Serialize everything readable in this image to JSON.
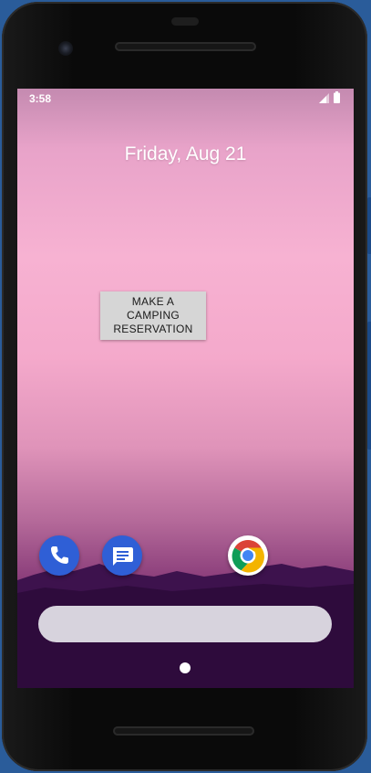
{
  "status_bar": {
    "time": "3:58",
    "signal_icon": "cellular-signal-icon",
    "battery_icon": "battery-icon"
  },
  "home": {
    "date": "Friday, Aug 21",
    "widget_button_label": "MAKE A CAMPING RESERVATION"
  },
  "dock": {
    "apps": [
      {
        "icon": "phone-icon",
        "color": "#2f5fd6"
      },
      {
        "icon": "messages-icon",
        "color": "#2f5fd6"
      },
      {
        "icon": "chrome-icon",
        "color": "#ffffff"
      }
    ]
  },
  "search_bar": {
    "icon": "search-bar"
  },
  "colors": {
    "wallpaper_top": "#f7b2d2",
    "wallpaper_bottom": "#3a1045",
    "widget_bg": "#d6d6d6",
    "search_bar_bg": "#d7d3dd"
  }
}
